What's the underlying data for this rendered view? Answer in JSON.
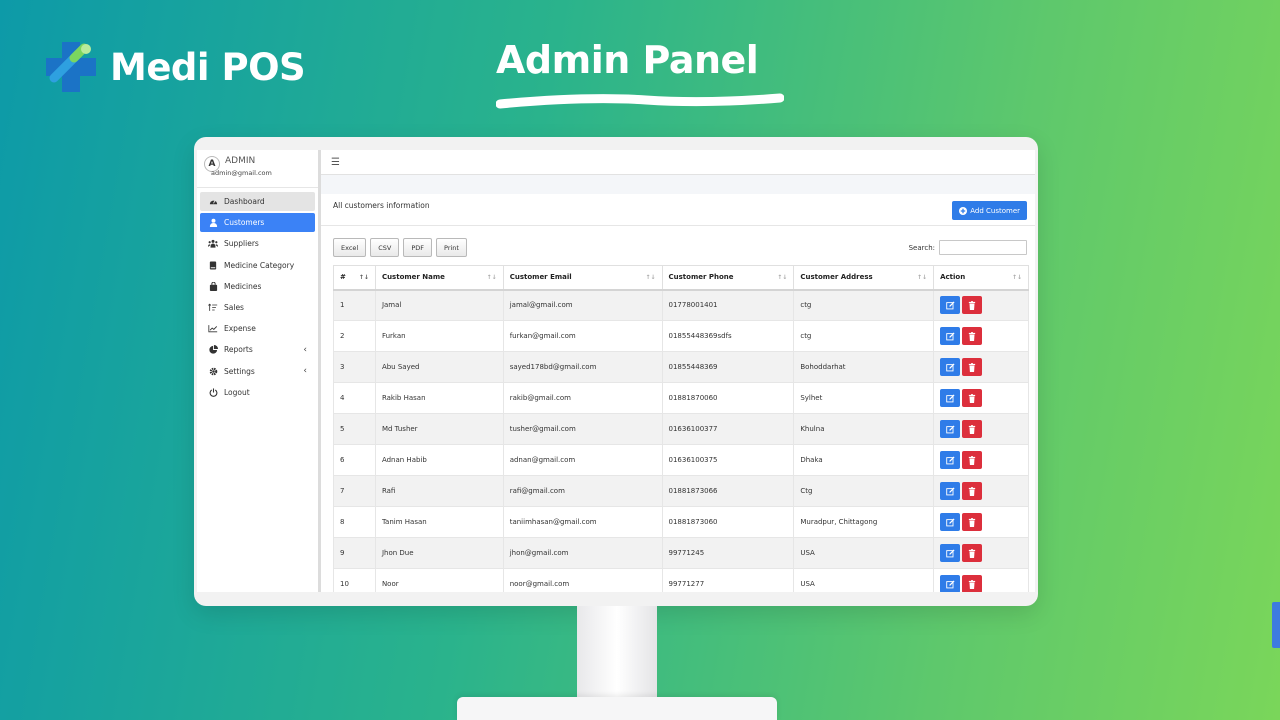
{
  "brand": {
    "name": "Medi POS",
    "headline": "Admin Panel",
    "logo_colors": [
      "#1a6fc2",
      "#2ea0e0",
      "#7bd65f"
    ]
  },
  "profile": {
    "avatar_letter": "A",
    "name": "ADMIN",
    "email": "admin@gmail.com"
  },
  "sidebar": {
    "items": [
      {
        "label": "Dashboard",
        "icon": "dashboard-icon",
        "state": "hover"
      },
      {
        "label": "Customers",
        "icon": "user-icon",
        "state": "active"
      },
      {
        "label": "Suppliers",
        "icon": "users-icon",
        "state": ""
      },
      {
        "label": "Medicine Category",
        "icon": "book-icon",
        "state": ""
      },
      {
        "label": "Medicines",
        "icon": "bag-icon",
        "state": ""
      },
      {
        "label": "Sales",
        "icon": "sort-icon",
        "state": ""
      },
      {
        "label": "Expense",
        "icon": "chart-line-icon",
        "state": ""
      },
      {
        "label": "Reports",
        "icon": "pie-chart-icon",
        "state": "",
        "submenu": true
      },
      {
        "label": "Settings",
        "icon": "gear-icon",
        "state": "",
        "submenu": true
      },
      {
        "label": "Logout",
        "icon": "power-icon",
        "state": ""
      }
    ],
    "submenu_chevron": "‹"
  },
  "topbar": {
    "menu_icon": "☰"
  },
  "card": {
    "title": "All customers information",
    "add_label": "Add Customer"
  },
  "toolbar": {
    "buttons": [
      "Excel",
      "CSV",
      "PDF",
      "Print"
    ],
    "search_label": "Search:",
    "search_value": ""
  },
  "table": {
    "columns": [
      "#",
      "Customer Name",
      "Customer Email",
      "Customer Phone",
      "Customer Address",
      "Action"
    ],
    "rows": [
      [
        "1",
        "Jamal",
        "jamal@gmail.com",
        "01778001401",
        "ctg"
      ],
      [
        "2",
        "Furkan",
        "furkan@gmail.com",
        "01855448369sdfs",
        "ctg"
      ],
      [
        "3",
        "Abu Sayed",
        "sayed178bd@gmail.com",
        "01855448369",
        "Bohoddarhat"
      ],
      [
        "4",
        "Rakib Hasan",
        "rakib@gmail.com",
        "01881870060",
        "Sylhet"
      ],
      [
        "5",
        "Md Tusher",
        "tusher@gmail.com",
        "01636100377",
        "Khulna"
      ],
      [
        "6",
        "Adnan Habib",
        "adnan@gmail.com",
        "01636100375",
        "Dhaka"
      ],
      [
        "7",
        "Rafi",
        "rafi@gmail.com",
        "01881873066",
        "Ctg"
      ],
      [
        "8",
        "Tanim Hasan",
        "taniimhasan@gmail.com",
        "01881873060",
        "Muradpur, Chittagong"
      ],
      [
        "9",
        "Jhon Due",
        "jhon@gmail.com",
        "99771245",
        "USA"
      ],
      [
        "10",
        "Noor",
        "noor@gmail.com",
        "99771277",
        "USA"
      ]
    ]
  },
  "colors": {
    "primary": "#2f7ce8",
    "danger": "#dc2f3c",
    "sidebar_active": "#3b82f6"
  }
}
